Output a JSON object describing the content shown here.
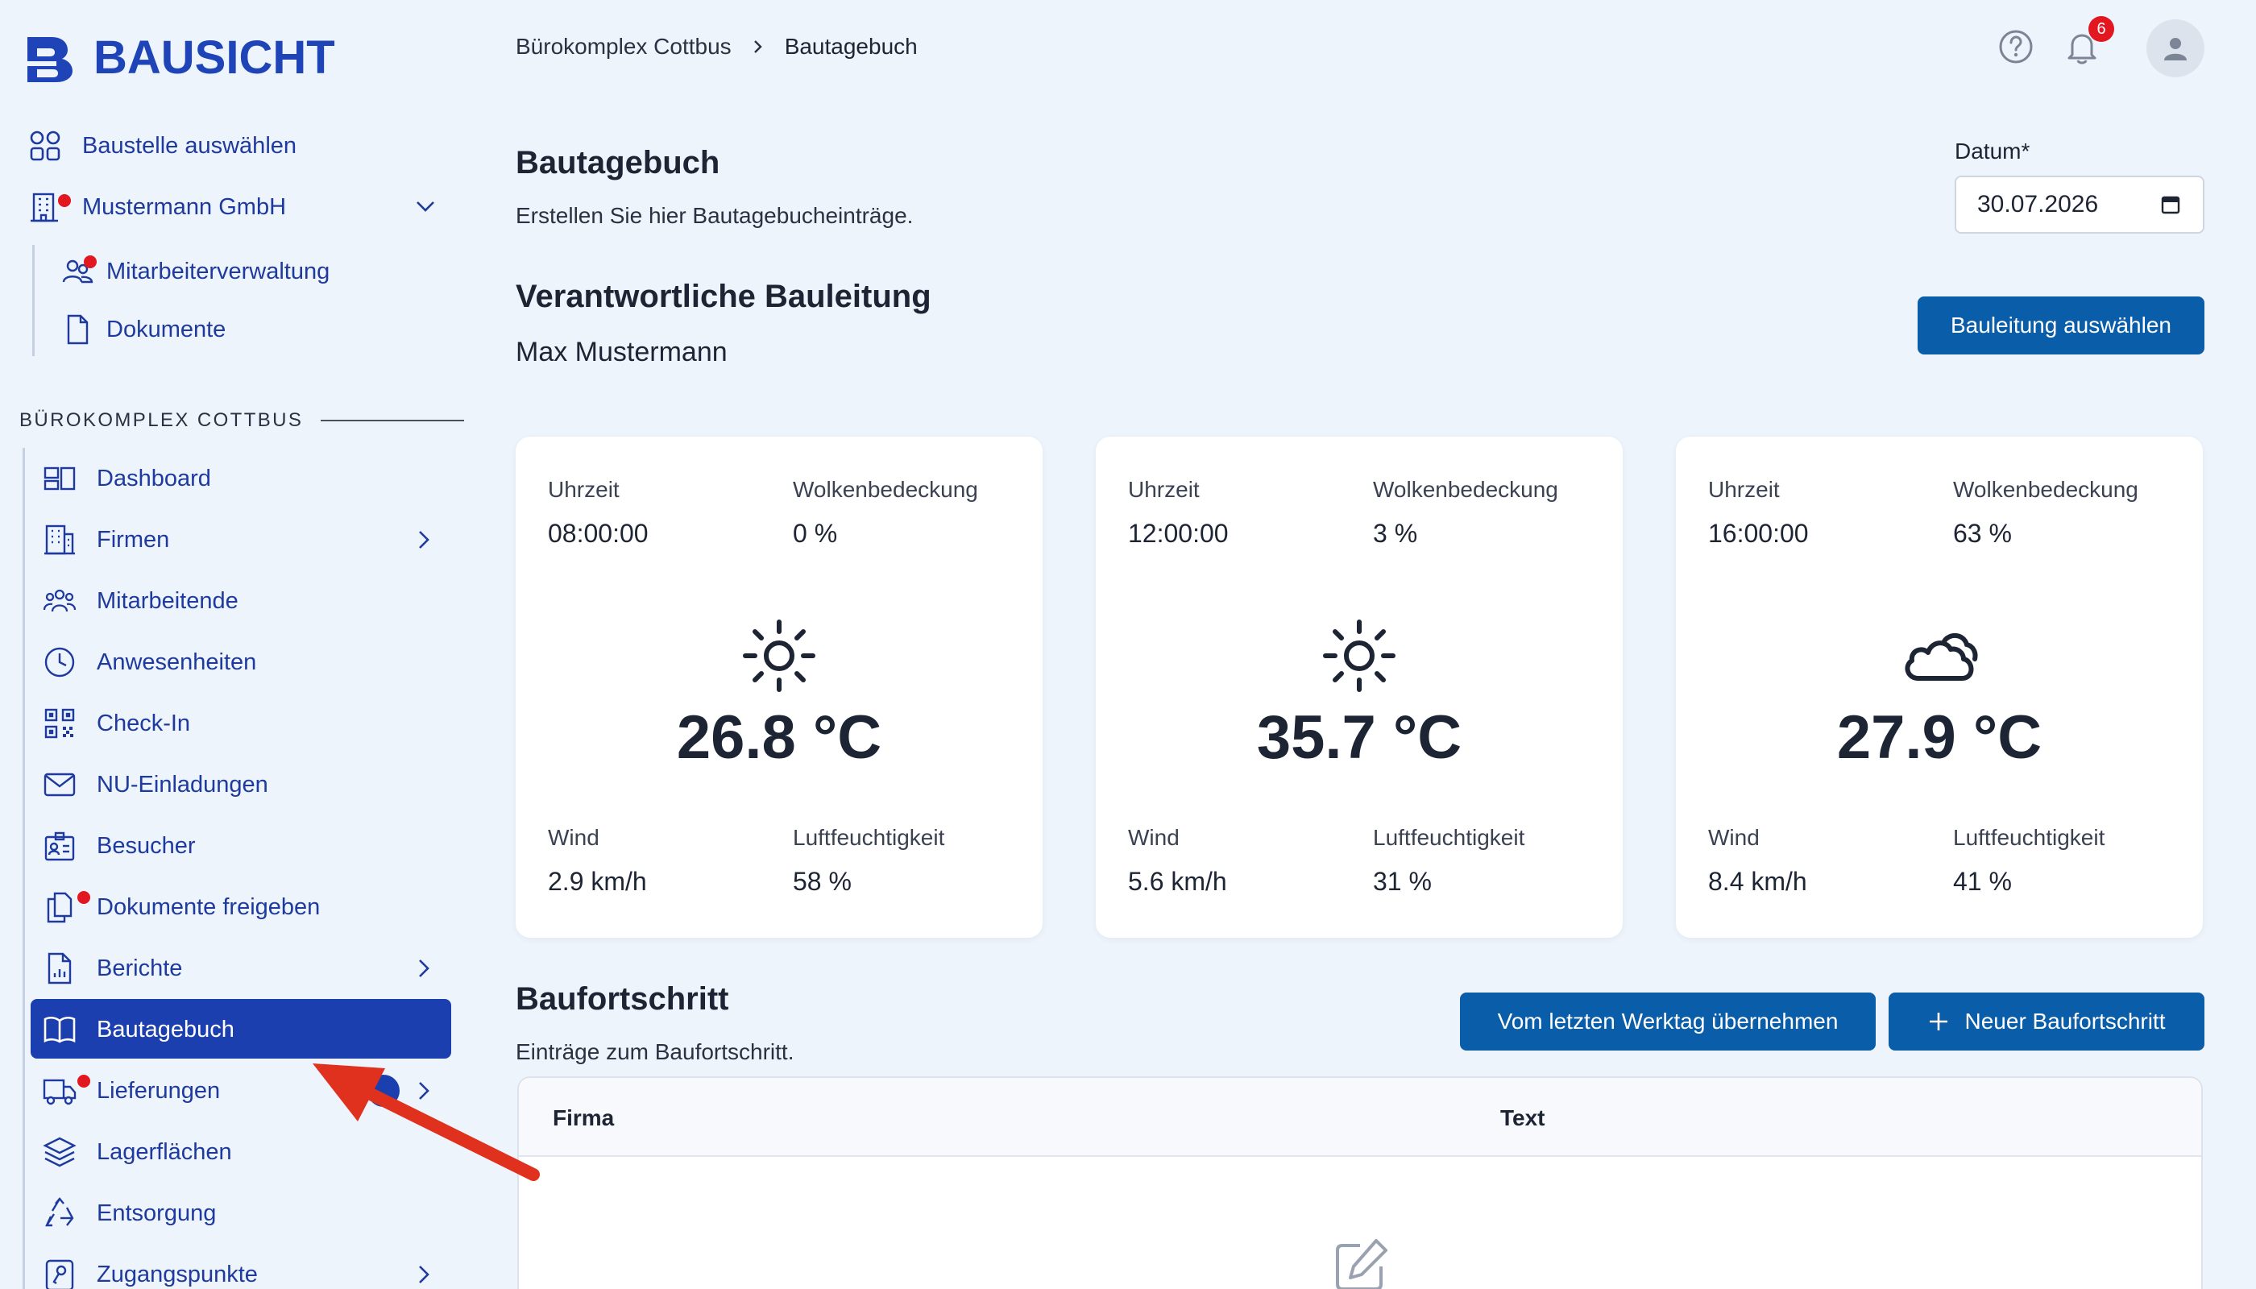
{
  "brand": {
    "name": "BAUSICHT",
    "color": "#1e44b8"
  },
  "sidebar": {
    "top_items": [
      {
        "label": "Baustelle auswählen",
        "icon": "grid-icon"
      },
      {
        "label": "Mustermann GmbH",
        "icon": "building-icon",
        "has_dot": true,
        "expanded": true
      }
    ],
    "company_sub_items": [
      {
        "label": "Mitarbeiterverwaltung",
        "icon": "users-icon",
        "has_dot": true
      },
      {
        "label": "Dokumente",
        "icon": "document-icon"
      }
    ],
    "section_title": "BÜROKOMPLEX COTTBUS",
    "items": [
      {
        "label": "Dashboard",
        "icon": "dashboard-icon"
      },
      {
        "label": "Firmen",
        "icon": "building-icon",
        "has_chevron": true
      },
      {
        "label": "Mitarbeitende",
        "icon": "users-group-icon"
      },
      {
        "label": "Anwesenheiten",
        "icon": "clock-icon"
      },
      {
        "label": "Check-In",
        "icon": "qr-code-icon"
      },
      {
        "label": "NU-Einladungen",
        "icon": "envelope-icon"
      },
      {
        "label": "Besucher",
        "icon": "id-badge-icon"
      },
      {
        "label": "Dokumente freigeben",
        "icon": "documents-share-icon",
        "has_dot": true
      },
      {
        "label": "Berichte",
        "icon": "report-icon",
        "has_chevron": true
      },
      {
        "label": "Bautagebuch",
        "icon": "book-icon",
        "active": true
      },
      {
        "label": "Lieferungen",
        "icon": "truck-icon",
        "has_dot": true,
        "has_chevron": true
      },
      {
        "label": "Lagerflächen",
        "icon": "layers-icon"
      },
      {
        "label": "Entsorgung",
        "icon": "recycle-icon"
      },
      {
        "label": "Zugangspunkte",
        "icon": "key-icon",
        "has_chevron": true
      }
    ]
  },
  "header": {
    "breadcrumb": [
      "Bürokomplex Cottbus",
      "Bautagebuch"
    ],
    "notification_count": "6"
  },
  "page": {
    "title": "Bautagebuch",
    "subtitle": "Erstellen Sie hier Bautagebucheinträge.",
    "date_label": "Datum*",
    "date_value": "30.07.2026"
  },
  "bauleitung": {
    "title": "Verantwortliche Bauleitung",
    "name": "Max Mustermann",
    "button": "Bauleitung auswählen"
  },
  "weather": {
    "labels": {
      "time": "Uhrzeit",
      "clouds": "Wolkenbedeckung",
      "wind": "Wind",
      "humidity": "Luftfeuchtigkeit"
    },
    "cards": [
      {
        "time": "08:00:00",
        "clouds": "0 %",
        "temp": "26.8 °C",
        "wind": "2.9 km/h",
        "humidity": "58 %",
        "icon": "sun-icon"
      },
      {
        "time": "12:00:00",
        "clouds": "3 %",
        "temp": "35.7 °C",
        "wind": "5.6 km/h",
        "humidity": "31 %",
        "icon": "sun-icon"
      },
      {
        "time": "16:00:00",
        "clouds": "63 %",
        "temp": "27.9 °C",
        "wind": "8.4 km/h",
        "humidity": "41 %",
        "icon": "cloud-icon"
      }
    ]
  },
  "progress": {
    "title": "Baufortschritt",
    "subtitle": "Einträge zum Baufortschritt.",
    "copy_button": "Vom letzten Werktag übernehmen",
    "new_button": "Neuer Baufortschritt",
    "columns": [
      "Firma",
      "Text"
    ]
  },
  "colors": {
    "accent": "#1c3fb0",
    "button": "#0a5da8",
    "dot": "#e3171f",
    "annotation_arrow": "#e0301e"
  }
}
